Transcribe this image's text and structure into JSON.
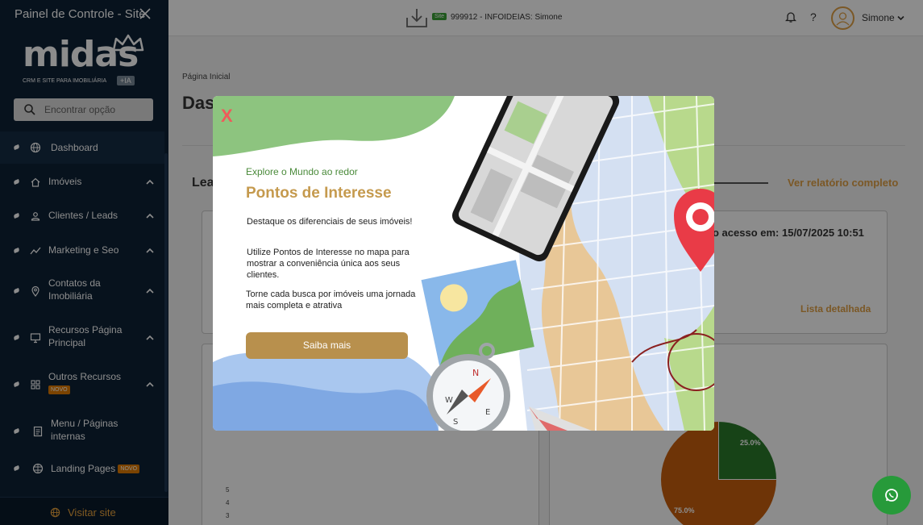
{
  "sidebar": {
    "title": "Painel de Controle - Site",
    "logo_text": "midas",
    "logo_subtitle": "CRM E SITE PARA IMOBILIÁRIA",
    "logo_badge": "+IA",
    "search_placeholder": "Encontrar opção",
    "items": [
      {
        "label": "Dashboard",
        "icon": "globe-icon"
      },
      {
        "label": "Imóveis",
        "icon": "home-icon"
      },
      {
        "label": "Clientes / Leads",
        "icon": "user-icon"
      },
      {
        "label": "Marketing e Seo",
        "icon": "trend-icon"
      },
      {
        "label": "Contatos da Imobiliária",
        "icon": "pin-icon"
      },
      {
        "label": "Recursos Página Principal",
        "icon": "monitor-icon"
      },
      {
        "label": "Outros Recursos",
        "icon": "grid-icon",
        "badge": "NOVO"
      },
      {
        "label": "Menu / Páginas internas",
        "icon": "document-icon"
      },
      {
        "label": "Landing Pages",
        "icon": "world-icon",
        "badge": "NOVO"
      }
    ],
    "visit_label": "Visitar site"
  },
  "topbar": {
    "site_badge": "Site",
    "site_text": "999912 - INFOIDEIAS: Simone",
    "help": "?",
    "user_name": "Simone"
  },
  "main": {
    "breadcrumb": "Página Inicial",
    "title": "Das",
    "section_label": "Lea",
    "report_link": "Ver relatório completo",
    "last_access": "o acesso em: 15/07/2025 10:51",
    "detail_link": "Lista detalhada",
    "y_ticks": [
      "5",
      "4",
      "3"
    ],
    "pie_labels": [
      "25.0%",
      "75.0%"
    ]
  },
  "chart_data": {
    "type": "pie",
    "categories": [
      "",
      ""
    ],
    "values": [
      25.0,
      75.0
    ],
    "colors": [
      "#2a7a2a",
      "#c8600e"
    ]
  },
  "modal": {
    "close": "X",
    "kicker": "Explore o Mundo ao redor",
    "title": "Pontos de Interesse",
    "p1": "Destaque os diferenciais de seus imóveis!",
    "p2": "Utilize Pontos de Interesse no mapa para mostrar a conveniência única aos seus clientes.",
    "p3": "Torne cada busca por imóveis uma jornada mais completa e atrativa",
    "button": "Saiba mais"
  },
  "colors": {
    "sidebar_bg": "#0d2136",
    "accent": "#e0a045",
    "modal_button": "#b8904d",
    "whatsapp": "#279a3a"
  }
}
